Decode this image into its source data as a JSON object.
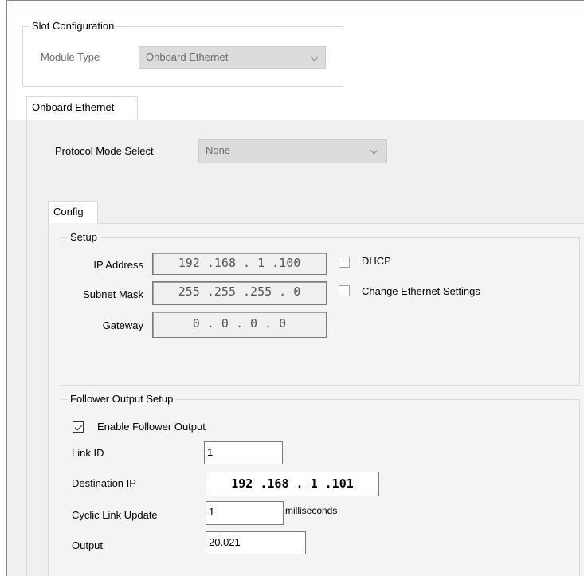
{
  "slot_config": {
    "title": "Slot Configuration",
    "module_type_label": "Module Type",
    "module_type_value": "Onboard Ethernet"
  },
  "module_tab": {
    "label": "Onboard Ethernet"
  },
  "protocol": {
    "label": "Protocol Mode Select",
    "value": "None"
  },
  "config_tab": {
    "label": "Config"
  },
  "setup": {
    "title": "Setup",
    "ip_label": "IP Address",
    "ip_value": "192 .168 . 1 .100",
    "subnet_label": "Subnet Mask",
    "subnet_value": "255 .255 .255 . 0",
    "gateway_label": "Gateway",
    "gateway_value": "0 . 0 . 0 . 0",
    "dhcp_label": "DHCP",
    "dhcp_checked": false,
    "change_eth_label": "Change Ethernet Settings",
    "change_eth_checked": false
  },
  "follower": {
    "title": "Follower Output Setup",
    "enable_label": "Enable Follower Output",
    "enable_checked": true,
    "link_id_label": "Link ID",
    "link_id_value": "1",
    "dest_ip_label": "Destination IP",
    "dest_ip_value": "192 .168 . 1 .101",
    "cyclic_label": "Cyclic Link Update",
    "cyclic_value": "1",
    "cyclic_unit": "milliseconds",
    "output_label": "Output",
    "output_value": "20.021"
  },
  "colors": {
    "panel": "#f0f0f0",
    "disabled_combo": "#dcdcdc",
    "group_border": "#d9d9d9"
  }
}
